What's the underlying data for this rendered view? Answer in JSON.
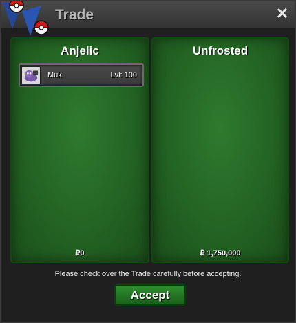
{
  "window": {
    "title": "Trade",
    "close_icon": "close-icon"
  },
  "left_panel": {
    "player": "Anjelic",
    "money": "₽0",
    "items": [
      {
        "name": "Muk",
        "level": "Lvl: 100"
      }
    ]
  },
  "right_panel": {
    "player": "Unfrosted",
    "money": "₽ 1,750,000"
  },
  "footer": {
    "notice": "Please check over the Trade carefully before accepting.",
    "accept_label": "Accept"
  },
  "colors": {
    "panel_green": "#236323",
    "accept_green": "#2f8f2f"
  }
}
